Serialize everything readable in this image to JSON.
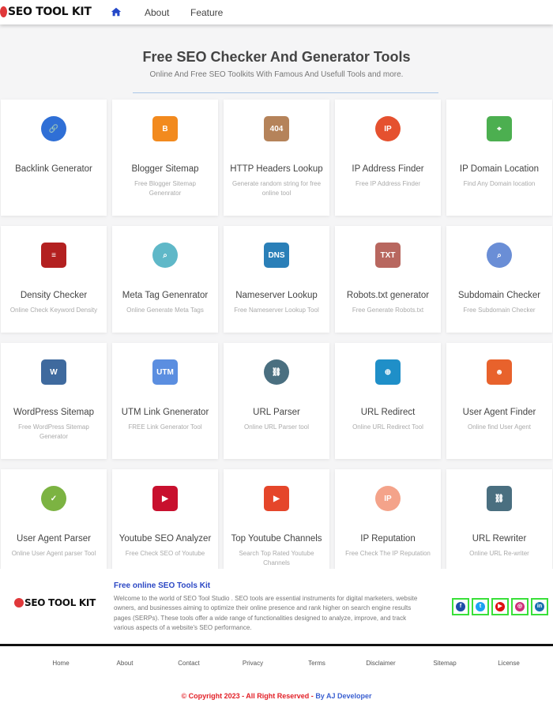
{
  "header": {
    "logo": "SEO TOOL KIT",
    "nav": [
      {
        "icon": "home-icon"
      },
      {
        "label": "About"
      },
      {
        "label": "Feature"
      }
    ]
  },
  "hero": {
    "title": "Free SEO Checker And Generator Tools",
    "subtitle": "Online And Free SEO Toolkits With Famous And Usefull Tools and more."
  },
  "tools": [
    {
      "title": "Backlink Generator",
      "desc": "",
      "icon": "link-icon",
      "color": "#2f6fd6",
      "glyph": "🔗"
    },
    {
      "title": "Blogger Sitemap",
      "desc": "Free Blogger Sitemap Genenrator",
      "icon": "blogger-icon",
      "color": "#f28a1e",
      "glyph": "B"
    },
    {
      "title": "HTTP Headers Lookup",
      "desc": "Generate random string for free online tool",
      "icon": "404-page-icon",
      "color": "#b5835a",
      "glyph": "404"
    },
    {
      "title": "IP Address Finder",
      "desc": "Free IP Address Finder",
      "icon": "ip-icon",
      "color": "#e5512f",
      "glyph": "IP"
    },
    {
      "title": "IP Domain Location",
      "desc": "Find Any Domain location",
      "icon": "map-pin-icon",
      "color": "#4caf50",
      "glyph": "⌖"
    },
    {
      "title": "Density Checker",
      "desc": "Online Check Keyword Density",
      "icon": "document-list-icon",
      "color": "#b32020",
      "glyph": "≡"
    },
    {
      "title": "Meta Tag Genenrator",
      "desc": "Online Generate Meta Tags",
      "icon": "magnifier-tag-icon",
      "color": "#5fb8c8",
      "glyph": "⌕"
    },
    {
      "title": "Nameserver Lookup",
      "desc": "Free Nameserver Lookup Tool",
      "icon": "dns-icon",
      "color": "#2a7fb8",
      "glyph": "DNS"
    },
    {
      "title": "Robots.txt generator",
      "desc": "Free Generate Robots.txt",
      "icon": "txt-file-icon",
      "color": "#b8675f",
      "glyph": "TXT"
    },
    {
      "title": "Subdomain Checker",
      "desc": "Free Subdomain Checker",
      "icon": "search-icon",
      "color": "#6a8ed6",
      "glyph": "⌕"
    },
    {
      "title": "WordPress Sitemap",
      "desc": "Free WordPress Sitemap Generator",
      "icon": "wordpress-icon",
      "color": "#3f6a9e",
      "glyph": "W"
    },
    {
      "title": "UTM Link Gnenerator",
      "desc": "FREE Link Generator Tool",
      "icon": "browser-link-icon",
      "color": "#5b8ee0",
      "glyph": "UTM"
    },
    {
      "title": "URL Parser",
      "desc": "Online URL Parser tool",
      "icon": "document-link-icon",
      "color": "#4a6f80",
      "glyph": "⛓"
    },
    {
      "title": "URL Redirect",
      "desc": "Online URL Redirect Tool",
      "icon": "globe-redirect-icon",
      "color": "#1f8fc8",
      "glyph": "⊕"
    },
    {
      "title": "User Agent Finder",
      "desc": "Online find User Agent",
      "icon": "spy-user-icon",
      "color": "#e8622c",
      "glyph": "☻"
    },
    {
      "title": "User Agent Parser",
      "desc": "Online User Agent parser Tool",
      "icon": "user-shield-icon",
      "color": "#7cb342",
      "glyph": "✓"
    },
    {
      "title": "Youtube SEO Analyzer",
      "desc": "Free Check SEO of Youtube",
      "icon": "youtube-box-icon",
      "color": "#c8102e",
      "glyph": "▶"
    },
    {
      "title": "Top Youtube Channels",
      "desc": "Search Top Rated Youtube Channels",
      "icon": "youtube-icon",
      "color": "#e5462a",
      "glyph": "▶"
    },
    {
      "title": "IP Reputation",
      "desc": "Free Check The IP Reputation",
      "icon": "ip-pin-icon",
      "color": "#f4a38a",
      "glyph": "IP"
    },
    {
      "title": "URL Rewriter",
      "desc": "Online URL Re-writer",
      "icon": "document-link-icon",
      "color": "#4a6f80",
      "glyph": "⛓"
    }
  ],
  "footer": {
    "logo": "SEO TOOL KIT",
    "title": "Free online SEO Tools Kit",
    "text": "Welcome to the world of SEO Tool Studio . SEO tools are essential instruments for digital marketers, website owners, and businesses aiming to optimize their online presence and rank higher on search engine results pages (SERPs). These tools offer a wide range of functionalities designed to analyze, improve, and track various aspects of a website's SEO performance.",
    "social": [
      {
        "icon": "facebook-icon",
        "color": "#1f4fa8",
        "glyph": "f"
      },
      {
        "icon": "twitter-icon",
        "color": "#1da1f2",
        "glyph": "t"
      },
      {
        "icon": "youtube-icon",
        "color": "#e01010",
        "glyph": "▶"
      },
      {
        "icon": "instagram-icon",
        "color": "#d0307a",
        "glyph": "◎"
      },
      {
        "icon": "linkedin-icon",
        "color": "#1a6fb0",
        "glyph": "in"
      }
    ],
    "links": [
      "Home",
      "About",
      "Contact",
      "Privacy",
      "Terms",
      "Disclaimer",
      "Sitemap",
      "License"
    ],
    "copyright": "© Copyright 2023 - All Right Reserved - ",
    "author": "By AJ Developer"
  }
}
